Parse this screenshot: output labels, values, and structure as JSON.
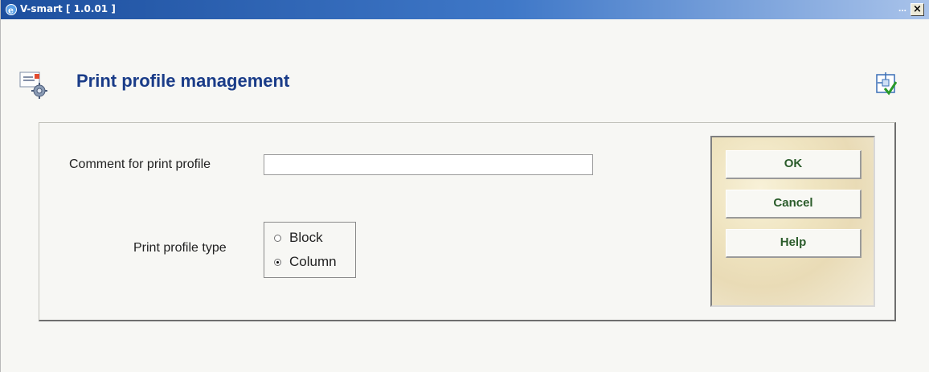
{
  "window": {
    "title": "V-smart [ 1.0.01 ]",
    "title_dots": "...",
    "close_glyph": "×"
  },
  "header": {
    "title": "Print profile management",
    "icon": "print-profile-icon",
    "confirm_icon": "confirm-check-icon"
  },
  "form": {
    "comment_label": "Comment for print profile",
    "comment_value": "",
    "type_label": "Print profile type",
    "type_options": [
      {
        "label": "Block",
        "checked": false
      },
      {
        "label": "Column",
        "checked": true
      }
    ]
  },
  "buttons": {
    "ok": "OK",
    "cancel": "Cancel",
    "help": "Help"
  },
  "colors": {
    "title_accent": "#1a3c88",
    "button_text": "#2b5c2b",
    "titlebar": "#1d4f9e"
  }
}
